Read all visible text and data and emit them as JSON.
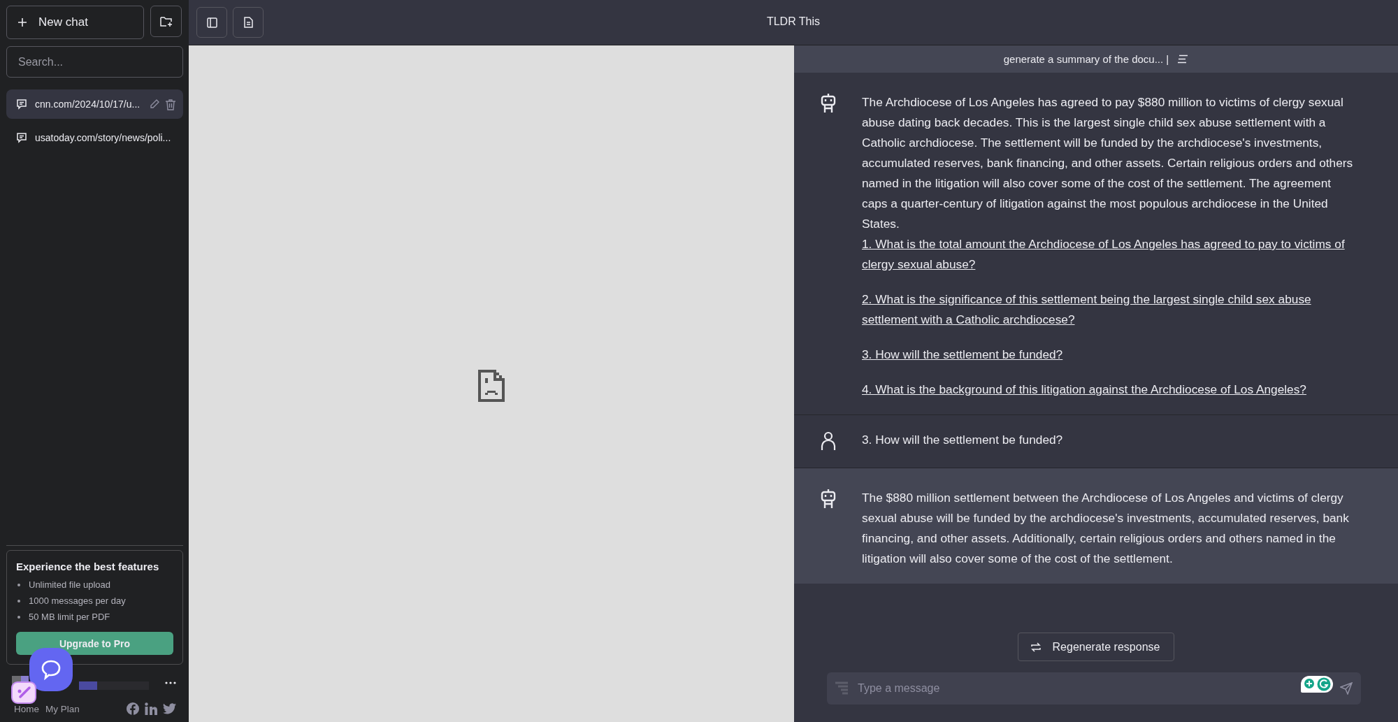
{
  "sidebar": {
    "new_chat": "New chat",
    "search": {
      "placeholder": "Search..."
    },
    "chats": [
      {
        "title": "cnn.com/2024/10/17/u...",
        "selected": true
      },
      {
        "title": "usatoday.com/story/news/poli...",
        "selected": false
      }
    ],
    "promo": {
      "title": "Experience the best features",
      "features": [
        "Unlimited file upload",
        "1000 messages per day",
        "50 MB limit per PDF"
      ],
      "button": "Upgrade to Pro"
    },
    "footer_links": [
      "Home",
      "My Plan"
    ]
  },
  "header": {
    "title": "TLDR This"
  },
  "chat": {
    "prompt_bar": "generate a summary of the docu... |",
    "messages": [
      {
        "kind": "bot",
        "highlighted": false,
        "text": "The Archdiocese of Los Angeles has agreed to pay $880 million to victims of clergy sexual abuse dating back decades. This is the largest single child sex abuse settlement with a Catholic archdiocese. The settlement will be funded by the archdiocese's investments, accumulated reserves, bank financing, and other assets. Certain religious orders and others named in the litigation will also cover some of the cost of the settlement. The agreement caps a quarter-century of litigation against the most populous archdiocese in the United States.",
        "questions": [
          "1. What is the total amount the Archdiocese of Los Angeles has agreed to pay to victims of clergy sexual abuse?",
          "2. What is the significance of this settlement being the largest single child sex abuse settlement with a Catholic archdiocese?",
          "3. How will the settlement be funded?",
          "4. What is the background of this litigation against the Archdiocese of Los Angeles?"
        ]
      },
      {
        "kind": "user",
        "highlighted": false,
        "text": "3. How will the settlement be funded?"
      },
      {
        "kind": "bot",
        "highlighted": true,
        "text": "The $880 million settlement between the Archdiocese of Los Angeles and victims of clergy sexual abuse will be funded by the archdiocese's investments, accumulated reserves, bank financing, and other assets. Additionally, certain religious orders and others named in the litigation will also cover some of the cost of the settlement."
      }
    ],
    "regenerate": "Regenerate response",
    "input": {
      "placeholder": "Type a message"
    }
  }
}
